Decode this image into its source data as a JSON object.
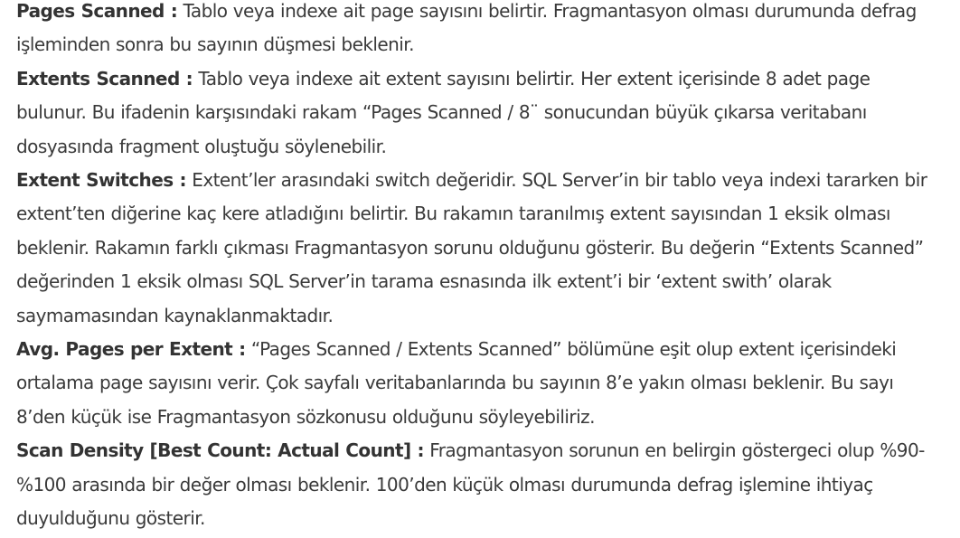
{
  "definitions": [
    {
      "term": "Pages Scanned :",
      "text": " Tablo veya indexe ait page sayısını belirtir. Fragmantasyon olması durumunda defrag işleminden sonra bu sayının düşmesi beklenir."
    },
    {
      "term": "Extents Scanned :",
      "text": " Tablo veya indexe ait extent sayısını belirtir. Her extent içerisinde 8 adet page bulunur. Bu ifadenin karşısındaki rakam “Pages Scanned / 8¨ sonucundan büyük çıkarsa veritabanı dosyasında fragment oluştuğu söylenebilir."
    },
    {
      "term": "Extent Switches :",
      "text": " Extent’ler arasındaki switch değeridir. SQL Server’in bir tablo veya indexi tararken bir extent’ten diğerine kaç kere atladığını belirtir. Bu rakamın taranılmış extent sayısından 1 eksik olması beklenir. Rakamın farklı çıkması Fragmantasyon sorunu olduğunu gösterir. Bu değerin “Extents Scanned” değerinden 1 eksik olması SQL Server’in tarama esnasında ilk extent’i bir ‘extent swith’ olarak saymamasından kaynaklanmaktadır."
    },
    {
      "term": "Avg. Pages per Extent :",
      "text": " “Pages Scanned / Extents Scanned” bölümüne eşit olup extent içerisindeki ortalama page sayısını verir. Çok sayfalı veritabanlarında bu sayının 8’e yakın olması beklenir. Bu sayı 8’den küçük ise Fragmantasyon sözkonusu olduğunu söyleyebiliriz."
    },
    {
      "term": "Scan Density [Best Count: Actual Count] :",
      "text": " Fragmantasyon sorunun en belirgin göstergeci olup %90-%100 arasında bir değer olması beklenir. 100’den küçük olması durumunda defrag işlemine ihtiyaç duyulduğunu gösterir."
    }
  ]
}
